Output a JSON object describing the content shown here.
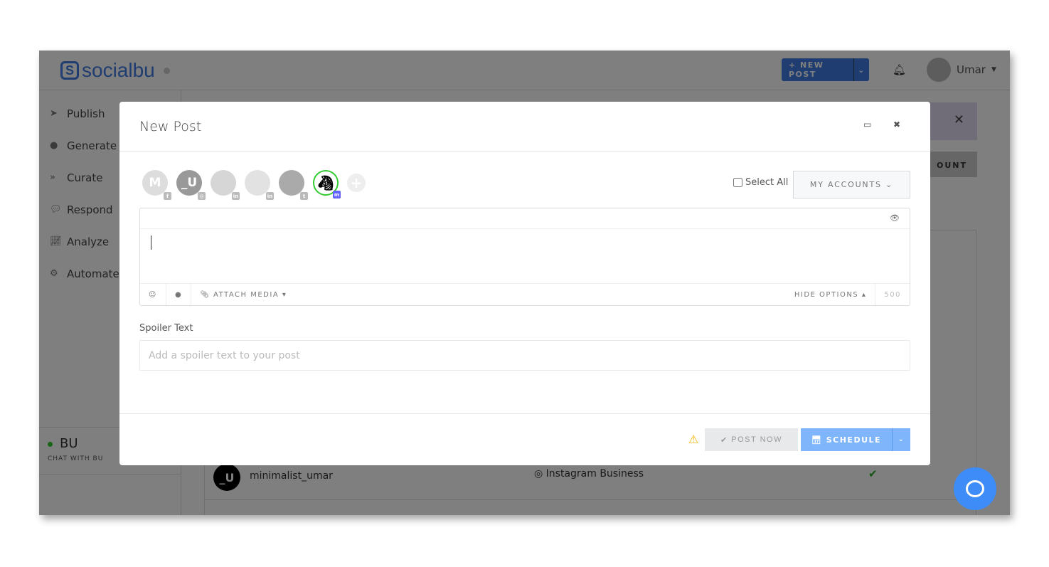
{
  "header": {
    "logo": "socialbu",
    "new_post": "+ NEW POST",
    "user": "Umar"
  },
  "sidebar": {
    "items": [
      {
        "label": "Publish",
        "icon": "paper-plane-icon"
      },
      {
        "label": "Generate",
        "icon": "robot-icon"
      },
      {
        "label": "Curate",
        "icon": "share-arrows-icon"
      },
      {
        "label": "Respond",
        "icon": "comments-icon"
      },
      {
        "label": "Analyze",
        "icon": "line-chart-icon"
      },
      {
        "label": "Automate",
        "icon": "gears-icon"
      }
    ],
    "bu_title": "BU",
    "bu_sub": "CHAT WITH BU"
  },
  "background": {
    "button_partial": "OUNT",
    "row_account": "minimalist_umar",
    "row_type": "Instagram Business",
    "row_avatar": "_U"
  },
  "modal": {
    "title": "New Post",
    "accounts": [
      {
        "initial": "M",
        "network": "facebook"
      },
      {
        "initial": "_U",
        "network": "instagram"
      },
      {
        "initial": "",
        "network": "linkedin"
      },
      {
        "initial": "",
        "network": "linkedin"
      },
      {
        "initial": "",
        "network": "twitter"
      },
      {
        "initial": "",
        "network": "mastodon",
        "selected": true
      }
    ],
    "select_all": "Select All",
    "my_accounts": "MY ACCOUNTS",
    "attach_media": "ATTACH MEDIA",
    "hide_options": "HIDE OPTIONS",
    "char_count": "500",
    "spoiler_label": "Spoiler Text",
    "spoiler_placeholder": "Add a spoiler text to your post",
    "post_now": "POST NOW",
    "schedule": "SCHEDULE"
  },
  "colors": {
    "accent": "#3e7be0",
    "schedule": "#7fb5fb",
    "warning": "#f5b400"
  }
}
